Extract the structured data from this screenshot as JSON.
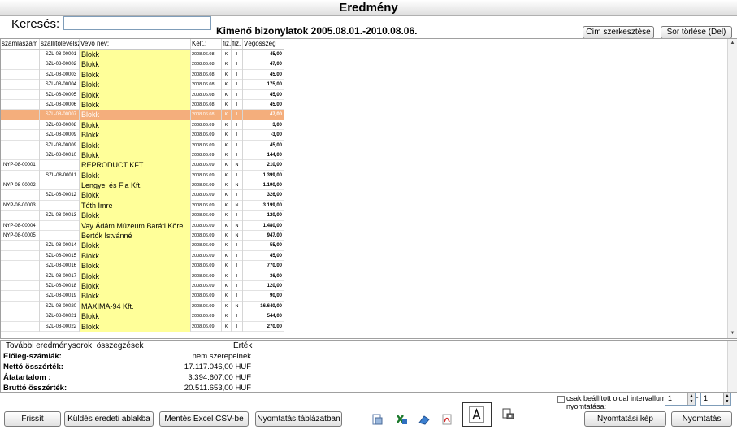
{
  "window": {
    "title": "Eredmény"
  },
  "search": {
    "label": "Keresés:",
    "value": "",
    "placeholder": ""
  },
  "report_title": "Kimenő bizonylatok 2005.08.01.-2010.08.06.",
  "top_buttons": {
    "cim": "Cím szerkesztése",
    "sor": "Sor törlése (Del)"
  },
  "grid": {
    "columns": [
      "számlaszám",
      "szállítólevélsz",
      "Vevő név:",
      "Kelt.:",
      "fiz.",
      "fiz.",
      "Végösszeg"
    ],
    "rows": [
      {
        "szamla": "",
        "szall": "SZL-08-00001",
        "vevo": "Blokk",
        "kelt": "2008.06.08.",
        "f1": "K",
        "f2": "I",
        "osszeg": "45,00",
        "selected": false
      },
      {
        "szamla": "",
        "szall": "SZL-08-00002",
        "vevo": "Blokk",
        "kelt": "2008.06.08.",
        "f1": "K",
        "f2": "I",
        "osszeg": "47,00",
        "selected": false
      },
      {
        "szamla": "",
        "szall": "SZL-08-00003",
        "vevo": "Blokk",
        "kelt": "2008.06.08.",
        "f1": "K",
        "f2": "I",
        "osszeg": "45,00",
        "selected": false
      },
      {
        "szamla": "",
        "szall": "SZL-08-00004",
        "vevo": "Blokk",
        "kelt": "2008.06.08.",
        "f1": "K",
        "f2": "I",
        "osszeg": "175,00",
        "selected": false
      },
      {
        "szamla": "",
        "szall": "SZL-08-00005",
        "vevo": "Blokk",
        "kelt": "2008.06.08.",
        "f1": "K",
        "f2": "I",
        "osszeg": "45,00",
        "selected": false
      },
      {
        "szamla": "",
        "szall": "SZL-08-00006",
        "vevo": "Blokk",
        "kelt": "2008.06.08.",
        "f1": "K",
        "f2": "I",
        "osszeg": "45,00",
        "selected": false
      },
      {
        "szamla": "",
        "szall": "SZL-08-00007",
        "vevo": "Blokk",
        "kelt": "2008.06.08.",
        "f1": "K",
        "f2": "I",
        "osszeg": "47,00",
        "selected": true
      },
      {
        "szamla": "",
        "szall": "SZL-08-00008",
        "vevo": "Blokk",
        "kelt": "2008.06.09.",
        "f1": "K",
        "f2": "I",
        "osszeg": "3,00",
        "selected": false
      },
      {
        "szamla": "",
        "szall": "SZL-08-00009",
        "vevo": "Blokk",
        "kelt": "2008.06.09.",
        "f1": "K",
        "f2": "I",
        "osszeg": "-3,00",
        "selected": false
      },
      {
        "szamla": "",
        "szall": "SZL-08-00009",
        "vevo": "Blokk",
        "kelt": "2008.06.09.",
        "f1": "K",
        "f2": "I",
        "osszeg": "45,00",
        "selected": false
      },
      {
        "szamla": "",
        "szall": "SZL-08-00010",
        "vevo": "Blokk",
        "kelt": "2008.06.09.",
        "f1": "K",
        "f2": "I",
        "osszeg": "144,00",
        "selected": false
      },
      {
        "szamla": "NYP-08-00001",
        "szall": "",
        "vevo": "REPRODUCT KFT.",
        "kelt": "2008.06.09.",
        "f1": "K",
        "f2": "N",
        "osszeg": "210,00",
        "selected": false
      },
      {
        "szamla": "",
        "szall": "SZL-08-00011",
        "vevo": "Blokk",
        "kelt": "2008.06.09.",
        "f1": "K",
        "f2": "I",
        "osszeg": "1.399,00",
        "selected": false
      },
      {
        "szamla": "NYP-08-00002",
        "szall": "",
        "vevo": "Lengyel és Fia Kft.",
        "kelt": "2008.06.09.",
        "f1": "K",
        "f2": "N",
        "osszeg": "1.190,00",
        "selected": false
      },
      {
        "szamla": "",
        "szall": "SZL-08-00012",
        "vevo": "Blokk",
        "kelt": "2008.06.09.",
        "f1": "K",
        "f2": "I",
        "osszeg": "326,00",
        "selected": false
      },
      {
        "szamla": "NYP-08-00003",
        "szall": "",
        "vevo": "Tóth Imre",
        "kelt": "2008.06.09.",
        "f1": "K",
        "f2": "N",
        "osszeg": "3.199,00",
        "selected": false
      },
      {
        "szamla": "",
        "szall": "SZL-08-00013",
        "vevo": "Blokk",
        "kelt": "2008.06.09.",
        "f1": "K",
        "f2": "I",
        "osszeg": "120,00",
        "selected": false
      },
      {
        "szamla": "NYP-08-00004",
        "szall": "",
        "vevo": "Vay Ádám Múzeum Baráti Köre",
        "kelt": "2008.06.09.",
        "f1": "K",
        "f2": "N",
        "osszeg": "1.480,00",
        "selected": false
      },
      {
        "szamla": "NYP-08-00005",
        "szall": "",
        "vevo": "Bertók Istvánné",
        "kelt": "2008.06.09.",
        "f1": "K",
        "f2": "N",
        "osszeg": "947,00",
        "selected": false
      },
      {
        "szamla": "",
        "szall": "SZL-08-00014",
        "vevo": "Blokk",
        "kelt": "2008.06.09.",
        "f1": "K",
        "f2": "I",
        "osszeg": "55,00",
        "selected": false
      },
      {
        "szamla": "",
        "szall": "SZL-08-00015",
        "vevo": "Blokk",
        "kelt": "2008.06.09.",
        "f1": "K",
        "f2": "I",
        "osszeg": "45,00",
        "selected": false
      },
      {
        "szamla": "",
        "szall": "SZL-08-00016",
        "vevo": "Blokk",
        "kelt": "2008.06.09.",
        "f1": "K",
        "f2": "I",
        "osszeg": "770,00",
        "selected": false
      },
      {
        "szamla": "",
        "szall": "SZL-08-00017",
        "vevo": "Blokk",
        "kelt": "2008.06.09.",
        "f1": "K",
        "f2": "I",
        "osszeg": "36,00",
        "selected": false
      },
      {
        "szamla": "",
        "szall": "SZL-08-00018",
        "vevo": "Blokk",
        "kelt": "2008.06.09.",
        "f1": "K",
        "f2": "I",
        "osszeg": "120,00",
        "selected": false
      },
      {
        "szamla": "",
        "szall": "SZL-08-00019",
        "vevo": "Blokk",
        "kelt": "2008.06.09.",
        "f1": "K",
        "f2": "I",
        "osszeg": "90,00",
        "selected": false
      },
      {
        "szamla": "",
        "szall": "SZL-08-00020",
        "vevo": "MAXIMA-94 Kft.",
        "kelt": "2008.06.09.",
        "f1": "K",
        "f2": "N",
        "osszeg": "16.640,00",
        "selected": false
      },
      {
        "szamla": "",
        "szall": "SZL-08-00021",
        "vevo": "Blokk",
        "kelt": "2008.06.09.",
        "f1": "K",
        "f2": "I",
        "osszeg": "544,00",
        "selected": false
      },
      {
        "szamla": "",
        "szall": "SZL-08-00022",
        "vevo": "Blokk",
        "kelt": "2008.06.09.",
        "f1": "K",
        "f2": "I",
        "osszeg": "270,00",
        "selected": false
      }
    ]
  },
  "summary": {
    "header_key": "További eredménysorok, összegzések",
    "header_value": "Érték",
    "rows": [
      {
        "key": "Előleg-számlák:",
        "value": "nem szerepelnek"
      },
      {
        "key": "Nettó összérték:",
        "value": "17.117.046,00 HUF"
      },
      {
        "key": "Áfatartalom :",
        "value": "3.394.607,00 HUF"
      },
      {
        "key": "Bruttó összérték:",
        "value": "20.511.653,00 HUF"
      }
    ]
  },
  "print_range": {
    "label": "csak beállított oldal intervallum nyomtatása:",
    "from": "1",
    "to": "1",
    "dash": "-"
  },
  "bottom_buttons": {
    "frissit": "Frissít",
    "kuldes": "Küldés eredeti ablakba",
    "mentes": "Mentés Excel CSV-be",
    "nyomtatas_tablazat": "Nyomtatás táblázatban",
    "nyomtatasi_kep": "Nyomtatási kép",
    "nyomtatas": "Nyomtatás"
  },
  "colors": {
    "selected_row": "#f4ae7c",
    "name_cell": "#ffff99"
  }
}
